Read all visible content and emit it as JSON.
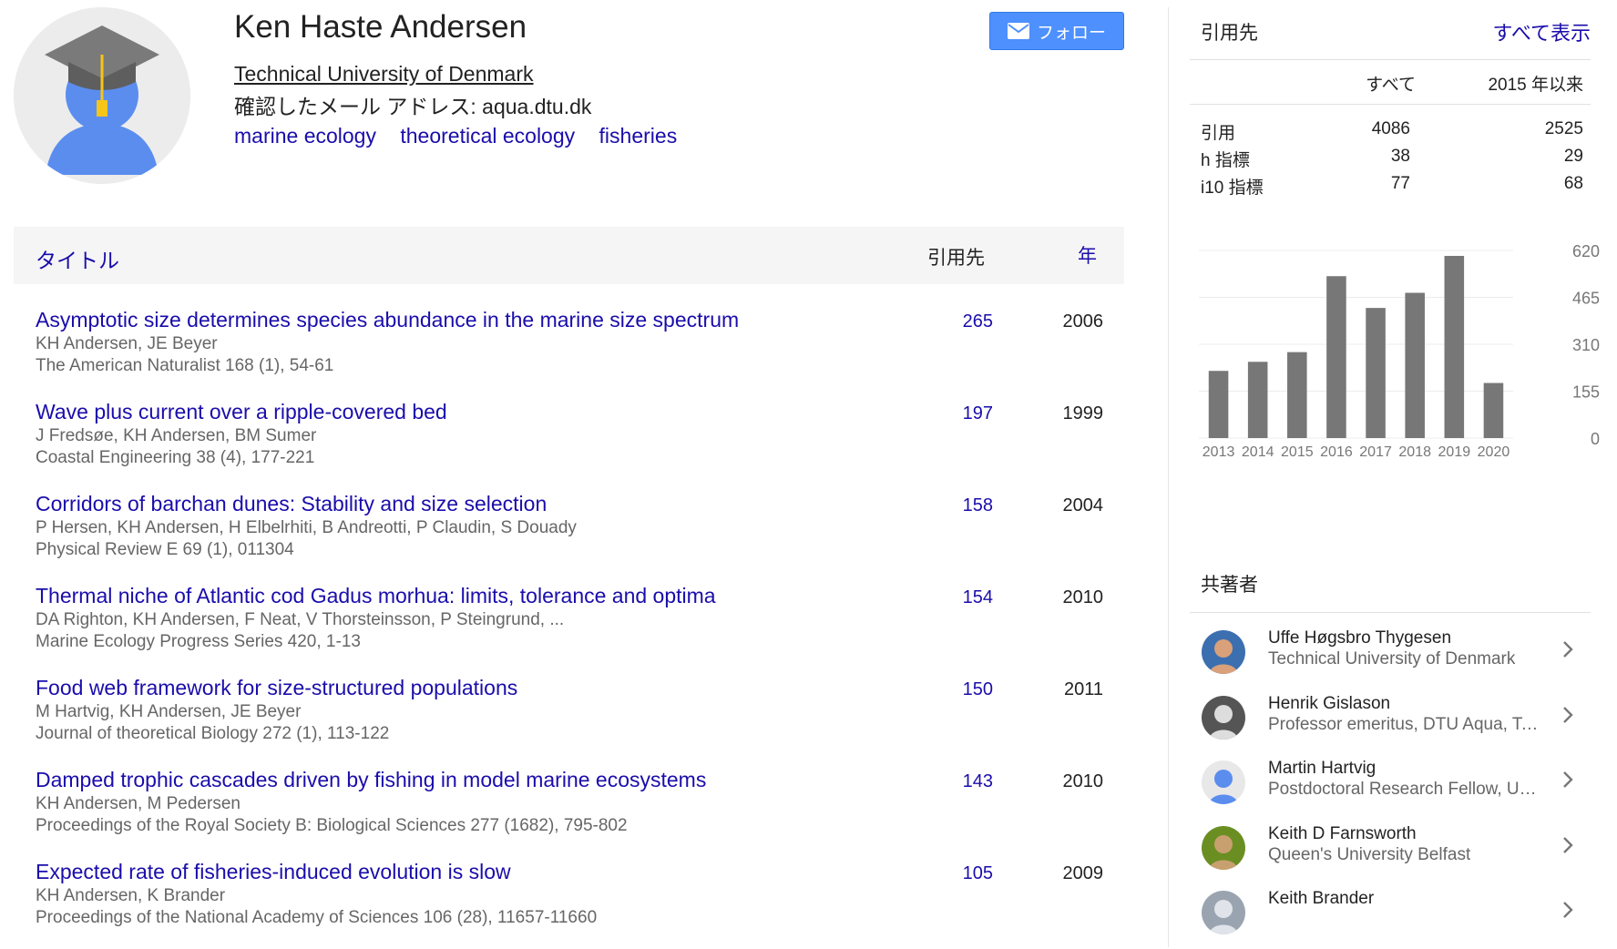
{
  "profile": {
    "name": "Ken Haste Andersen",
    "affiliation": "Technical University of Denmark",
    "email": "確認したメール アドレス: aqua.dtu.dk",
    "interests": [
      "marine ecology",
      "theoretical ecology",
      "fisheries"
    ],
    "follow_label": "フォロー",
    "avatar_icon": "default-scholar-avatar-icon"
  },
  "table": {
    "col_title": "タイトル",
    "col_cites": "引用先",
    "col_year": "年",
    "rows": [
      {
        "title": "Asymptotic size determines species abundance in the marine size spectrum",
        "authors": "KH Andersen, JE Beyer",
        "venue": "The American Naturalist 168 (1), 54-61",
        "cites": "265",
        "year": "2006"
      },
      {
        "title": "Wave plus current over a ripple-covered bed",
        "authors": "J Fredsøe, KH Andersen, BM Sumer",
        "venue": "Coastal Engineering 38 (4), 177-221",
        "cites": "197",
        "year": "1999"
      },
      {
        "title": "Corridors of barchan dunes: Stability and size selection",
        "authors": "P Hersen, KH Andersen, H Elbelrhiti, B Andreotti, P Claudin, S Douady",
        "venue": "Physical Review E 69 (1), 011304",
        "cites": "158",
        "year": "2004"
      },
      {
        "title": "Thermal niche of Atlantic cod Gadus morhua: limits, tolerance and optima",
        "authors": "DA Righton, KH Andersen, F Neat, V Thorsteinsson, P Steingrund, ...",
        "venue": "Marine Ecology Progress Series 420, 1-13",
        "cites": "154",
        "year": "2010"
      },
      {
        "title": "Food web framework for size-structured populations",
        "authors": "M Hartvig, KH Andersen, JE Beyer",
        "venue": "Journal of theoretical Biology 272 (1), 113-122",
        "cites": "150",
        "year": "2011"
      },
      {
        "title": "Damped trophic cascades driven by fishing in model marine ecosystems",
        "authors": "KH Andersen, M Pedersen",
        "venue": "Proceedings of the Royal Society B: Biological Sciences 277 (1682), 795-802",
        "cites": "143",
        "year": "2010"
      },
      {
        "title": "Expected rate of fisheries-induced evolution is slow",
        "authors": "KH Andersen, K Brander",
        "venue": "Proceedings of the National Academy of Sciences 106 (28), 11657-11660",
        "cites": "105",
        "year": "2009"
      }
    ]
  },
  "cited_by": {
    "title": "引用先",
    "view_all": "すべて表示",
    "col_all": "すべて",
    "col_since": "2015 年以来",
    "stats": [
      {
        "label": "引用",
        "all": "4086",
        "since": "2525"
      },
      {
        "label": "h 指標",
        "all": "38",
        "since": "29"
      },
      {
        "label": "i10 指標",
        "all": "77",
        "since": "68"
      }
    ]
  },
  "chart_data": {
    "type": "bar",
    "categories": [
      "2013",
      "2014",
      "2015",
      "2016",
      "2017",
      "2018",
      "2019",
      "2020"
    ],
    "values": [
      222,
      252,
      284,
      535,
      430,
      480,
      602,
      182
    ],
    "y_ticks": [
      "620",
      "465",
      "310",
      "155",
      "0"
    ],
    "ylim": [
      0,
      620
    ],
    "grid": true,
    "bar_color": "#777777"
  },
  "coauthors": {
    "title": "共著者",
    "items": [
      {
        "name": "Uffe Høgsbro Thygesen",
        "affiliation": "Technical University of Denmark"
      },
      {
        "name": "Henrik Gislason",
        "affiliation": "Professor emeritus, DTU Aqua, Technical University of Denmark"
      },
      {
        "name": "Martin Hartvig",
        "affiliation": "Postdoctoral Research Fellow, University of Copenhagen"
      },
      {
        "name": "Keith D Farnsworth",
        "affiliation": "Queen's University Belfast"
      },
      {
        "name": "Keith Brander",
        "affiliation": ""
      }
    ]
  },
  "colors": {
    "link": "#1a0dab",
    "follow_button": "#4d90fe",
    "header_bg": "#f5f5f5"
  }
}
